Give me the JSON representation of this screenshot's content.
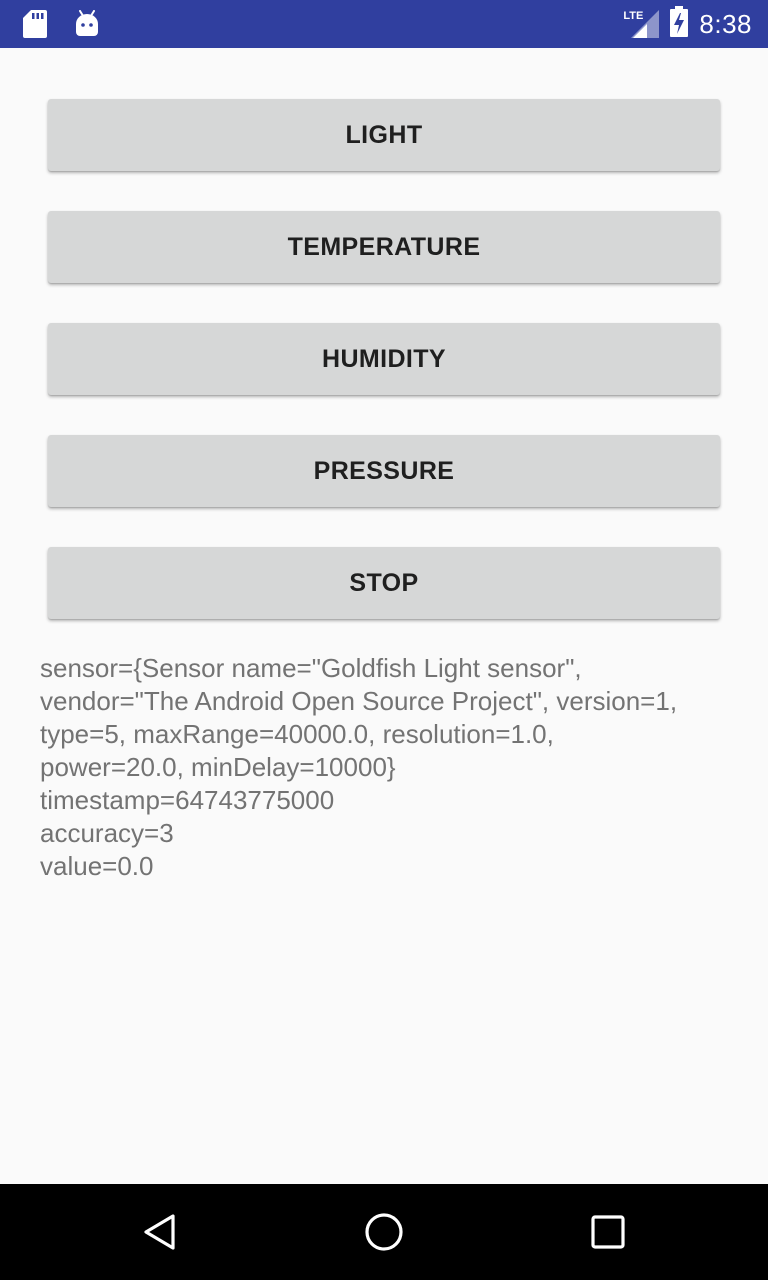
{
  "status_bar": {
    "time": "8:38",
    "network": "LTE",
    "icons": [
      "sd-card-icon",
      "android-icon",
      "lte-signal-icon",
      "battery-charging-icon"
    ]
  },
  "buttons": {
    "light": "LIGHT",
    "temperature": "TEMPERATURE",
    "humidity": "HUMIDITY",
    "pressure": "PRESSURE",
    "stop": "STOP"
  },
  "sensor_output": {
    "lines": [
      "sensor={Sensor name=\"Goldfish Light sensor\",",
      "vendor=\"The Android Open Source Project\", version=1,",
      "type=5, maxRange=40000.0, resolution=1.0,",
      "power=20.0, minDelay=10000}",
      "timestamp=64743775000",
      "accuracy=3",
      "value=0.0"
    ]
  },
  "nav_bar": {
    "icons": [
      "back-icon",
      "home-icon",
      "recents-icon"
    ]
  },
  "colors": {
    "status_bar": "#303f9f",
    "background": "#fafafa",
    "button": "#d6d7d7",
    "button_text": "#1f1f1f",
    "output_text": "#737373",
    "nav_bar": "#000000"
  }
}
